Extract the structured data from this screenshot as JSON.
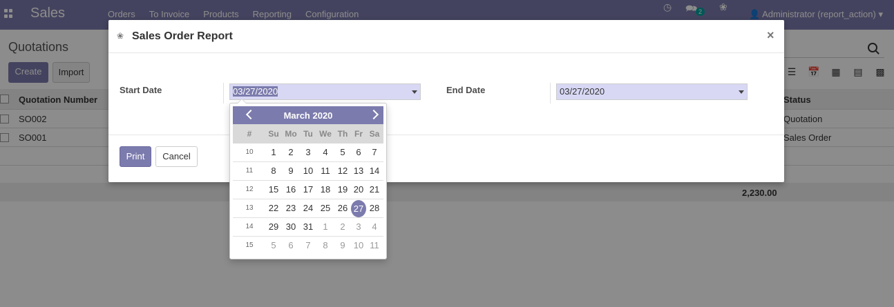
{
  "navbar": {
    "app_name": "Sales",
    "menu": [
      "Orders",
      "To Invoice",
      "Products",
      "Reporting",
      "Configuration"
    ],
    "message_count": "2",
    "user": "Administrator (report_action)"
  },
  "page": {
    "title": "Quotations",
    "create_label": "Create",
    "import_label": "Import"
  },
  "table": {
    "col_number": "Quotation Number",
    "col_status": "Status",
    "rows": [
      {
        "number": "SO002",
        "status": "Quotation"
      },
      {
        "number": "SO001",
        "status": "Sales Order"
      }
    ],
    "total": "2,230.00"
  },
  "dialog": {
    "title": "Sales Order Report",
    "start_label": "Start Date",
    "start_value": "03/27/2020",
    "end_label": "End Date",
    "end_value": "03/27/2020",
    "print_label": "Print",
    "cancel_label": "Cancel"
  },
  "datepicker": {
    "month_label": "March 2020",
    "week_col": "#",
    "weekdays": [
      "Su",
      "Mo",
      "Tu",
      "We",
      "Th",
      "Fr",
      "Sa"
    ],
    "weeks": [
      {
        "cw": "10",
        "days": [
          "1",
          "2",
          "3",
          "4",
          "5",
          "6",
          "7"
        ]
      },
      {
        "cw": "11",
        "days": [
          "8",
          "9",
          "10",
          "11",
          "12",
          "13",
          "14"
        ]
      },
      {
        "cw": "12",
        "days": [
          "15",
          "16",
          "17",
          "18",
          "19",
          "20",
          "21"
        ]
      },
      {
        "cw": "13",
        "days": [
          "22",
          "23",
          "24",
          "25",
          "26",
          "27",
          "28"
        ]
      },
      {
        "cw": "14",
        "days": [
          "29",
          "30",
          "31",
          "1",
          "2",
          "3",
          "4"
        ]
      },
      {
        "cw": "15",
        "days": [
          "5",
          "6",
          "7",
          "8",
          "9",
          "10",
          "11"
        ]
      }
    ],
    "selected_day": "27",
    "accent_color": "#7c7bad"
  }
}
